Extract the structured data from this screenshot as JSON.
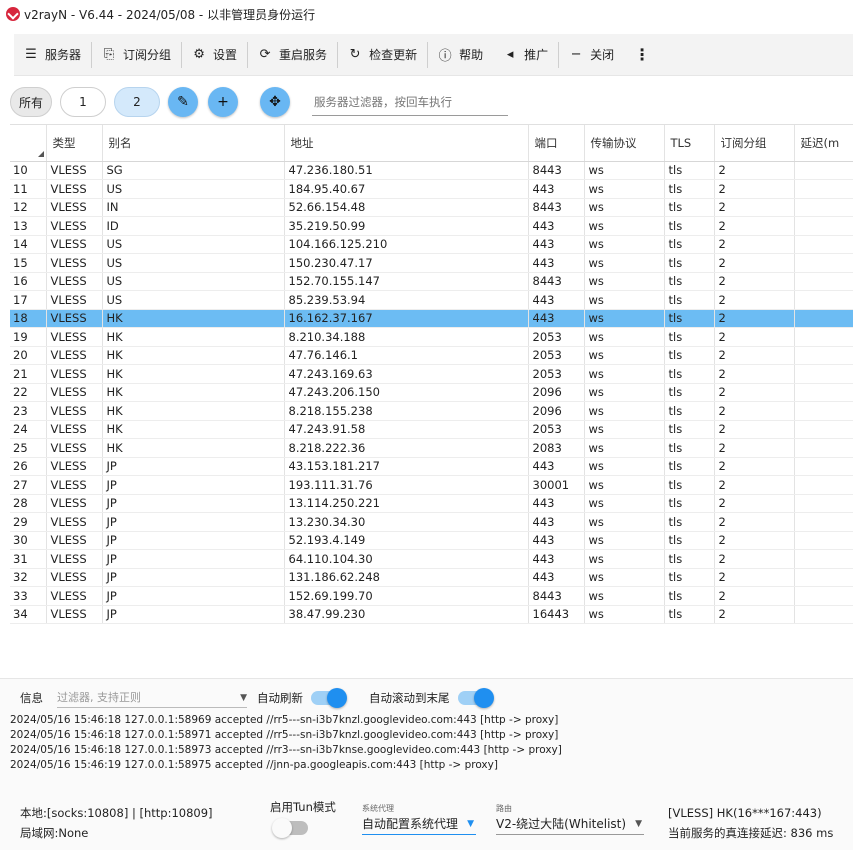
{
  "window": {
    "title": "v2rayN - V6.44 - 2024/05/08 - 以非管理员身份运行"
  },
  "toolbar": {
    "servers": "服务器",
    "subscription": "订阅分组",
    "settings": "设置",
    "restart": "重启服务",
    "check_update": "检查更新",
    "help": "帮助",
    "promote": "推广",
    "close": "关闭",
    "more": "⋮"
  },
  "filter": {
    "chip_all": "所有",
    "chip_1": "1",
    "chip_2": "2",
    "placeholder": "服务器过滤器，按回车执行"
  },
  "table": {
    "headers": [
      "",
      "类型",
      "别名",
      "地址",
      "端口",
      "传输协议",
      "TLS",
      "订阅分组",
      "延迟(m"
    ],
    "selected_row": "18",
    "rows": [
      [
        "10",
        "VLESS",
        "SG",
        "47.236.180.51",
        "8443",
        "ws",
        "tls",
        "2"
      ],
      [
        "11",
        "VLESS",
        "US",
        "184.95.40.67",
        "443",
        "ws",
        "tls",
        "2"
      ],
      [
        "12",
        "VLESS",
        "IN",
        "52.66.154.48",
        "8443",
        "ws",
        "tls",
        "2"
      ],
      [
        "13",
        "VLESS",
        "ID",
        "35.219.50.99",
        "443",
        "ws",
        "tls",
        "2"
      ],
      [
        "14",
        "VLESS",
        "US",
        "104.166.125.210",
        "443",
        "ws",
        "tls",
        "2"
      ],
      [
        "15",
        "VLESS",
        "US",
        "150.230.47.17",
        "443",
        "ws",
        "tls",
        "2"
      ],
      [
        "16",
        "VLESS",
        "US",
        "152.70.155.147",
        "8443",
        "ws",
        "tls",
        "2"
      ],
      [
        "17",
        "VLESS",
        "US",
        "85.239.53.94",
        "443",
        "ws",
        "tls",
        "2"
      ],
      [
        "18",
        "VLESS",
        "HK",
        "16.162.37.167",
        "443",
        "ws",
        "tls",
        "2"
      ],
      [
        "19",
        "VLESS",
        "HK",
        "8.210.34.188",
        "2053",
        "ws",
        "tls",
        "2"
      ],
      [
        "20",
        "VLESS",
        "HK",
        "47.76.146.1",
        "2053",
        "ws",
        "tls",
        "2"
      ],
      [
        "21",
        "VLESS",
        "HK",
        "47.243.169.63",
        "2053",
        "ws",
        "tls",
        "2"
      ],
      [
        "22",
        "VLESS",
        "HK",
        "47.243.206.150",
        "2096",
        "ws",
        "tls",
        "2"
      ],
      [
        "23",
        "VLESS",
        "HK",
        "8.218.155.238",
        "2096",
        "ws",
        "tls",
        "2"
      ],
      [
        "24",
        "VLESS",
        "HK",
        "47.243.91.58",
        "2053",
        "ws",
        "tls",
        "2"
      ],
      [
        "25",
        "VLESS",
        "HK",
        "8.218.222.36",
        "2083",
        "ws",
        "tls",
        "2"
      ],
      [
        "26",
        "VLESS",
        "JP",
        "43.153.181.217",
        "443",
        "ws",
        "tls",
        "2"
      ],
      [
        "27",
        "VLESS",
        "JP",
        "193.111.31.76",
        "30001",
        "ws",
        "tls",
        "2"
      ],
      [
        "28",
        "VLESS",
        "JP",
        "13.114.250.221",
        "443",
        "ws",
        "tls",
        "2"
      ],
      [
        "29",
        "VLESS",
        "JP",
        "13.230.34.30",
        "443",
        "ws",
        "tls",
        "2"
      ],
      [
        "30",
        "VLESS",
        "JP",
        "52.193.4.149",
        "443",
        "ws",
        "tls",
        "2"
      ],
      [
        "31",
        "VLESS",
        "JP",
        "64.110.104.30",
        "443",
        "ws",
        "tls",
        "2"
      ],
      [
        "32",
        "VLESS",
        "JP",
        "131.186.62.248",
        "443",
        "ws",
        "tls",
        "2"
      ],
      [
        "33",
        "VLESS",
        "JP",
        "152.69.199.70",
        "8443",
        "ws",
        "tls",
        "2"
      ],
      [
        "34",
        "VLESS",
        "JP",
        "38.47.99.230",
        "16443",
        "ws",
        "tls",
        "2"
      ]
    ]
  },
  "log": {
    "label": "信息",
    "filter_placeholder": "过滤器, 支持正则",
    "auto_refresh": "自动刷新",
    "auto_scroll": "自动滚动到末尾",
    "lines": [
      "2024/05/16 15:46:18 127.0.0.1:58969 accepted //rr5---sn-i3b7knzl.googlevideo.com:443 [http -> proxy]",
      "2024/05/16 15:46:18 127.0.0.1:58971 accepted //rr5---sn-i3b7knzl.googlevideo.com:443 [http -> proxy]",
      "2024/05/16 15:46:18 127.0.0.1:58973 accepted //rr3---sn-i3b7knse.googlevideo.com:443 [http -> proxy]",
      "2024/05/16 15:46:19 127.0.0.1:58975 accepted //jnn-pa.googleapis.com:443 [http -> proxy]"
    ]
  },
  "status": {
    "local": "本地:[socks:10808] | [http:10809]",
    "lan": "局域网:None",
    "tun_label": "启用Tun模式",
    "sysproxy_caption": "系统代理",
    "sysproxy_value": "自动配置系统代理",
    "route_caption": "路由",
    "route_value": "V2-绕过大陆(Whitelist)",
    "current_server": "[VLESS] HK(16***167:443)",
    "delay": "当前服务的真连接延迟: 836 ms"
  }
}
